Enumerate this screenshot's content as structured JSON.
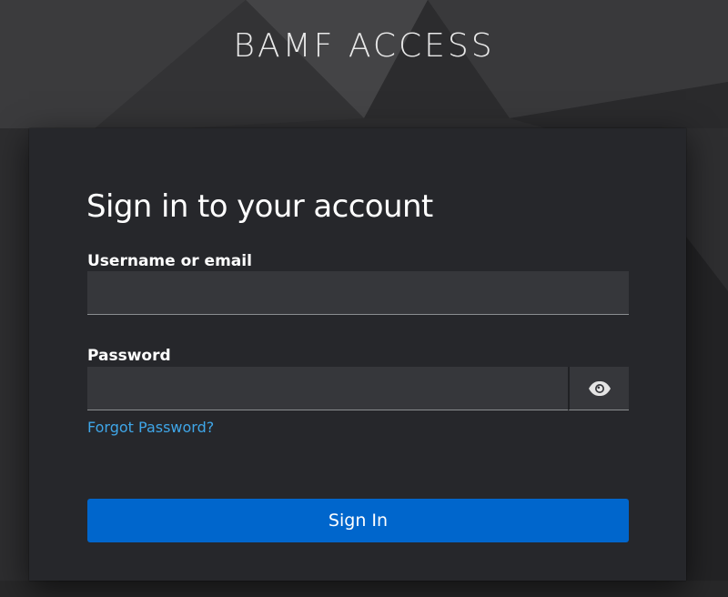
{
  "brand": {
    "title": "BAMF ACCESS"
  },
  "login": {
    "heading": "Sign in to your account",
    "username_label": "Username or email",
    "username_value": "",
    "password_label": "Password",
    "password_value": "",
    "forgot_link": "Forgot Password?",
    "submit_label": "Sign In",
    "show_password_icon": "eye-icon"
  },
  "colors": {
    "background": "#2f2f31",
    "card": "#26272b",
    "input": "#36373b",
    "link": "#3fa6e8",
    "primary": "#0066cc"
  }
}
